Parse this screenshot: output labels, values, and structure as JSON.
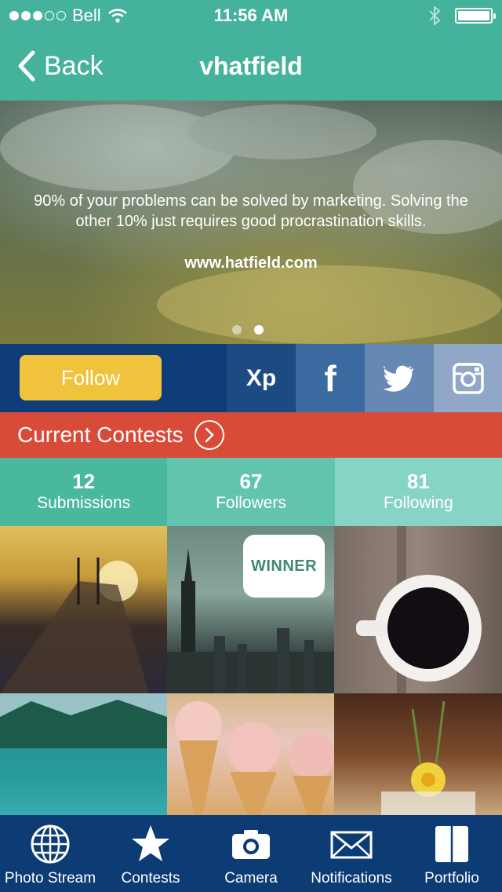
{
  "status_bar": {
    "carrier": "Bell",
    "time": "11:56 AM",
    "battery_level": 1.0
  },
  "nav": {
    "back_label": "Back",
    "title": "vhatfield"
  },
  "hero": {
    "quote": "90% of your problems can be solved by marketing. Solving the other 10% just requires good procrastination skills.",
    "link": "www.hatfield.com",
    "page_count": 2,
    "active_page": 2
  },
  "social": {
    "follow_label": "Follow",
    "xp_label": "Xp",
    "facebook_label": "f",
    "twitter_icon": "twitter-icon",
    "instagram_icon": "instagram-icon"
  },
  "contests": {
    "label": "Current Contests"
  },
  "stats": [
    {
      "value": "12",
      "label": "Submissions"
    },
    {
      "value": "67",
      "label": "Followers"
    },
    {
      "value": "81",
      "label": "Following"
    }
  ],
  "photos": {
    "winner_label": "WINNER",
    "items": [
      "pier-sunset",
      "city-skyline",
      "coffee-cup",
      "lake-forest",
      "cupcakes",
      "daffodil"
    ]
  },
  "tabs": [
    {
      "label": "Photo Stream",
      "icon": "globe-icon"
    },
    {
      "label": "Contests",
      "icon": "star-icon"
    },
    {
      "label": "Camera",
      "icon": "camera-icon"
    },
    {
      "label": "Notifications",
      "icon": "envelope-icon"
    },
    {
      "label": "Portfolio",
      "icon": "book-icon"
    }
  ],
  "colors": {
    "teal": "#45b29b",
    "navy": "#0d3b73",
    "red": "#d94b39",
    "yellow": "#f0c33c"
  }
}
